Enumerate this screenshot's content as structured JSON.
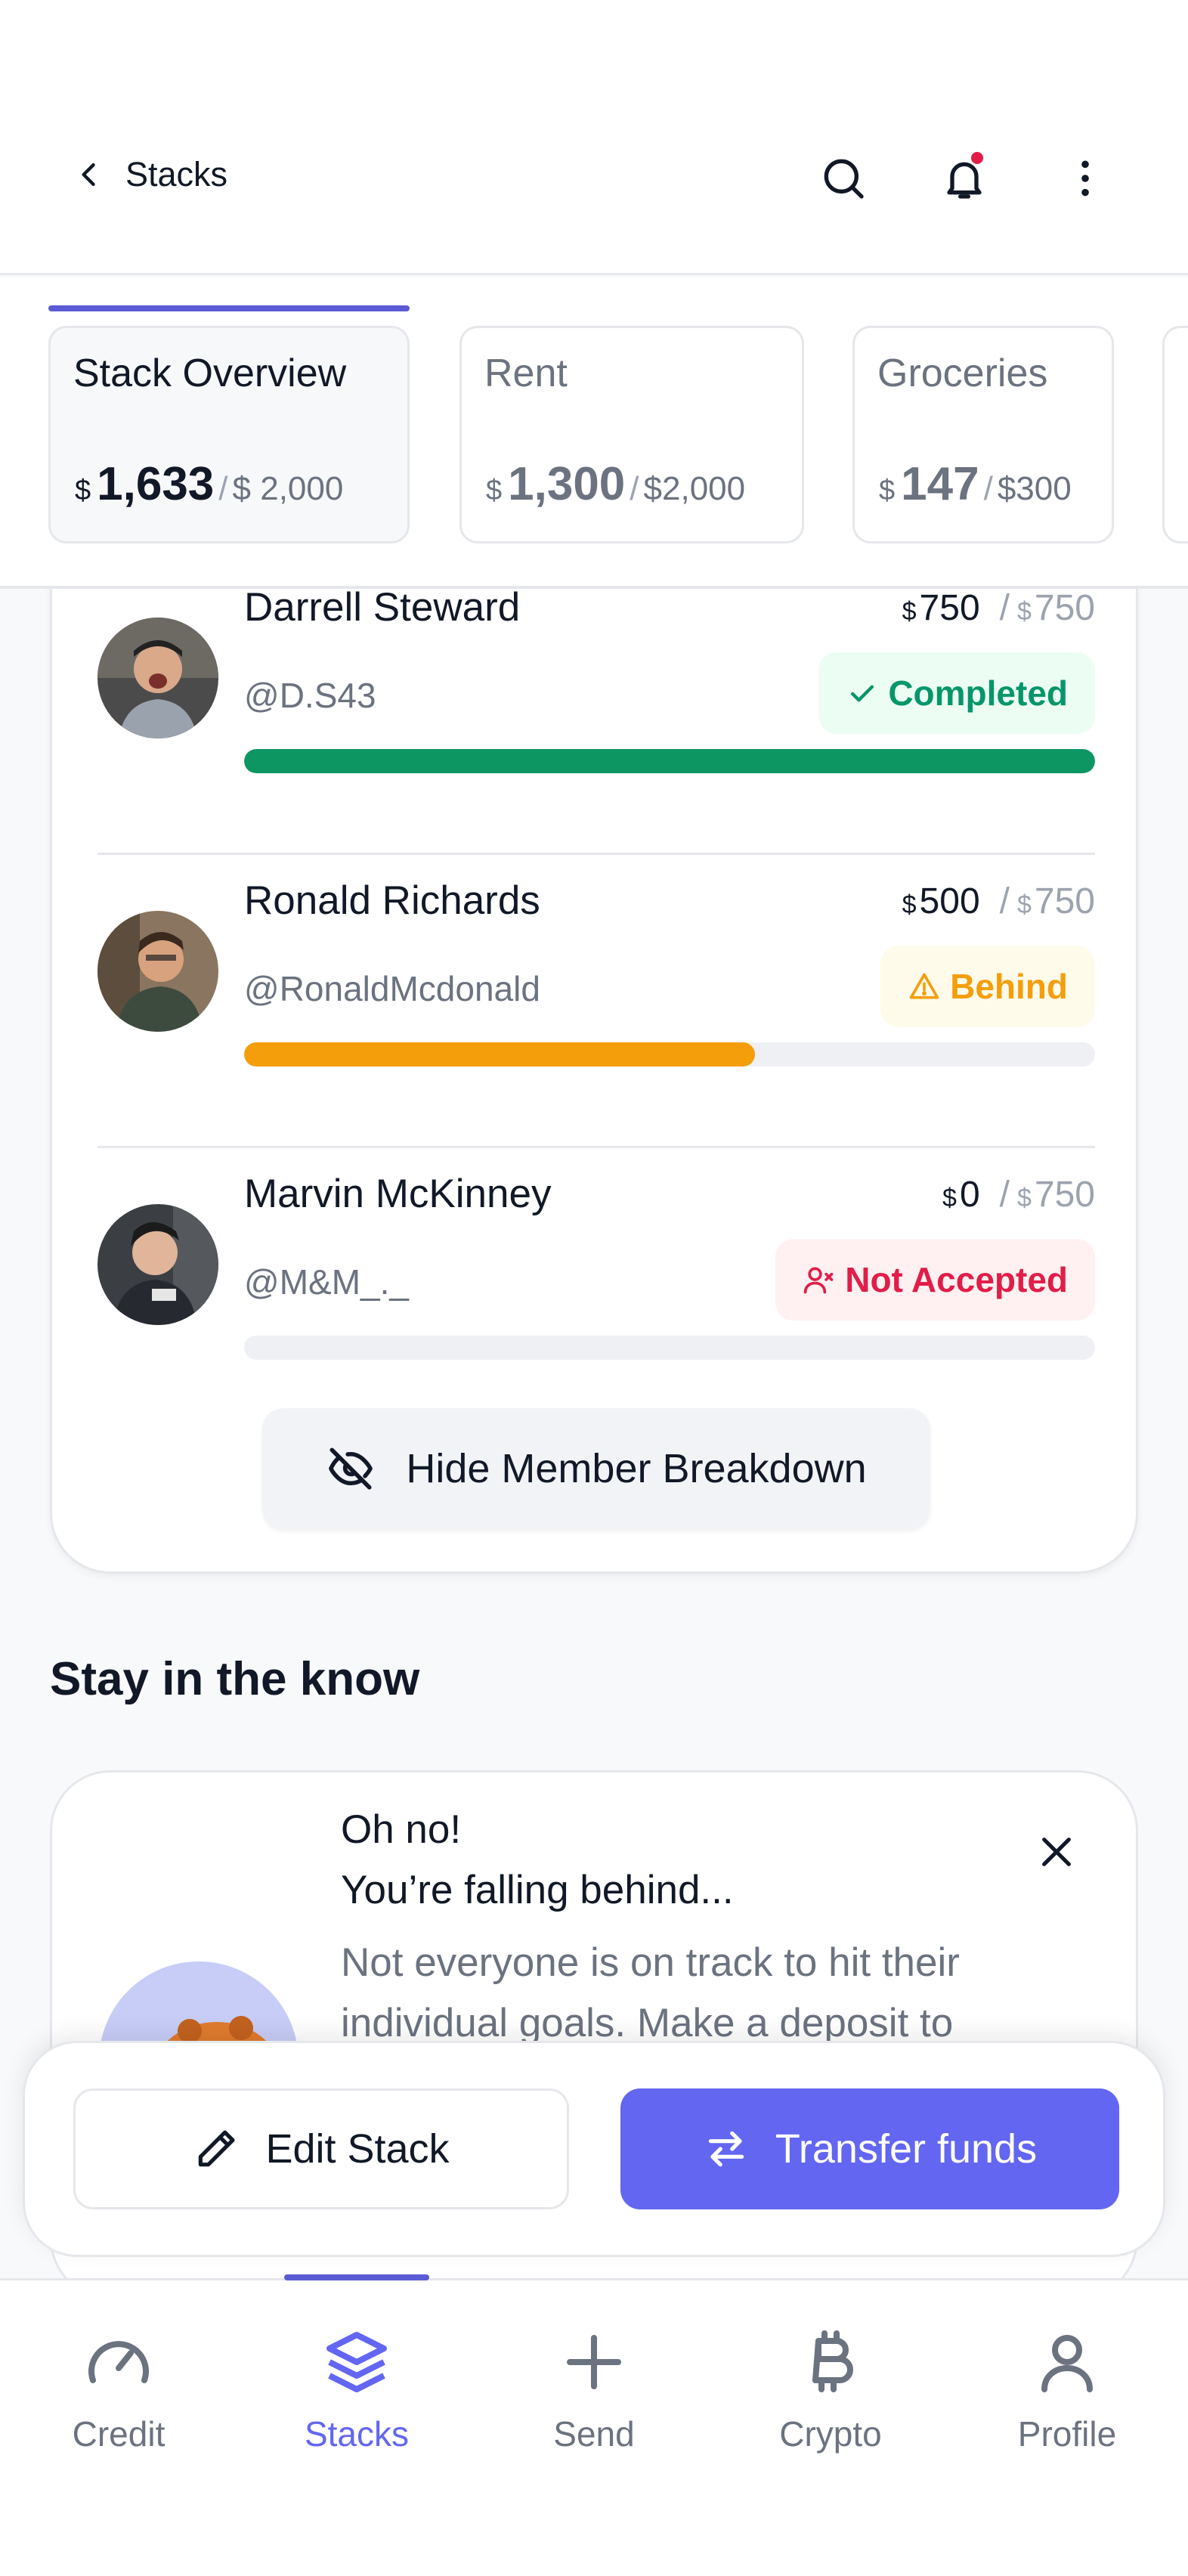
{
  "header": {
    "back_label": "Stacks"
  },
  "tabs": [
    {
      "title": "Stack Overview",
      "currency": "$",
      "amount": "1,633",
      "separator": "/",
      "goal": "$ 2,000",
      "active": true
    },
    {
      "title": "Rent",
      "currency": "$",
      "amount": "1,300",
      "separator": "/",
      "goal": "$2,000",
      "active": false
    },
    {
      "title": "Groceries",
      "currency": "$",
      "amount": "147",
      "separator": "/",
      "goal": "$300",
      "active": false
    }
  ],
  "members": [
    {
      "name": "Darrell Steward",
      "handle": "@D.S43",
      "currency": "$",
      "amount": "750",
      "goal": "750",
      "status": "Completed",
      "progress": 1.0
    },
    {
      "name": "Ronald Richards",
      "handle": "@RonaldMcdonald",
      "currency": "$",
      "amount": "500",
      "goal": "750",
      "status": "Behind",
      "progress": 0.6
    },
    {
      "name": "Marvin McKinney",
      "handle": "@M&M_._",
      "currency": "$",
      "amount": "0",
      "goal": "750",
      "status": "Not Accepted",
      "progress": 0.0
    }
  ],
  "hide_breakdown_label": "Hide Member Breakdown",
  "section_title": "Stay in the know",
  "notice": {
    "title_line1": "Oh no!",
    "title_line2": "You’re falling behind...",
    "body": "Not everyone is on track to hit their individual goals. Make a deposit to"
  },
  "actions": {
    "edit_label": "Edit Stack",
    "transfer_label": "Transfer funds"
  },
  "nav": [
    {
      "label": "Credit",
      "icon": "gauge-icon",
      "active": false
    },
    {
      "label": "Stacks",
      "icon": "layers-icon",
      "active": true
    },
    {
      "label": "Send",
      "icon": "plus-icon",
      "active": false
    },
    {
      "label": "Crypto",
      "icon": "bitcoin-icon",
      "active": false
    },
    {
      "label": "Profile",
      "icon": "user-icon",
      "active": false
    }
  ],
  "colors": {
    "accent": "#6366f1",
    "completed": "#059669",
    "behind": "#f59e0b",
    "not_accepted": "#e11d48"
  }
}
